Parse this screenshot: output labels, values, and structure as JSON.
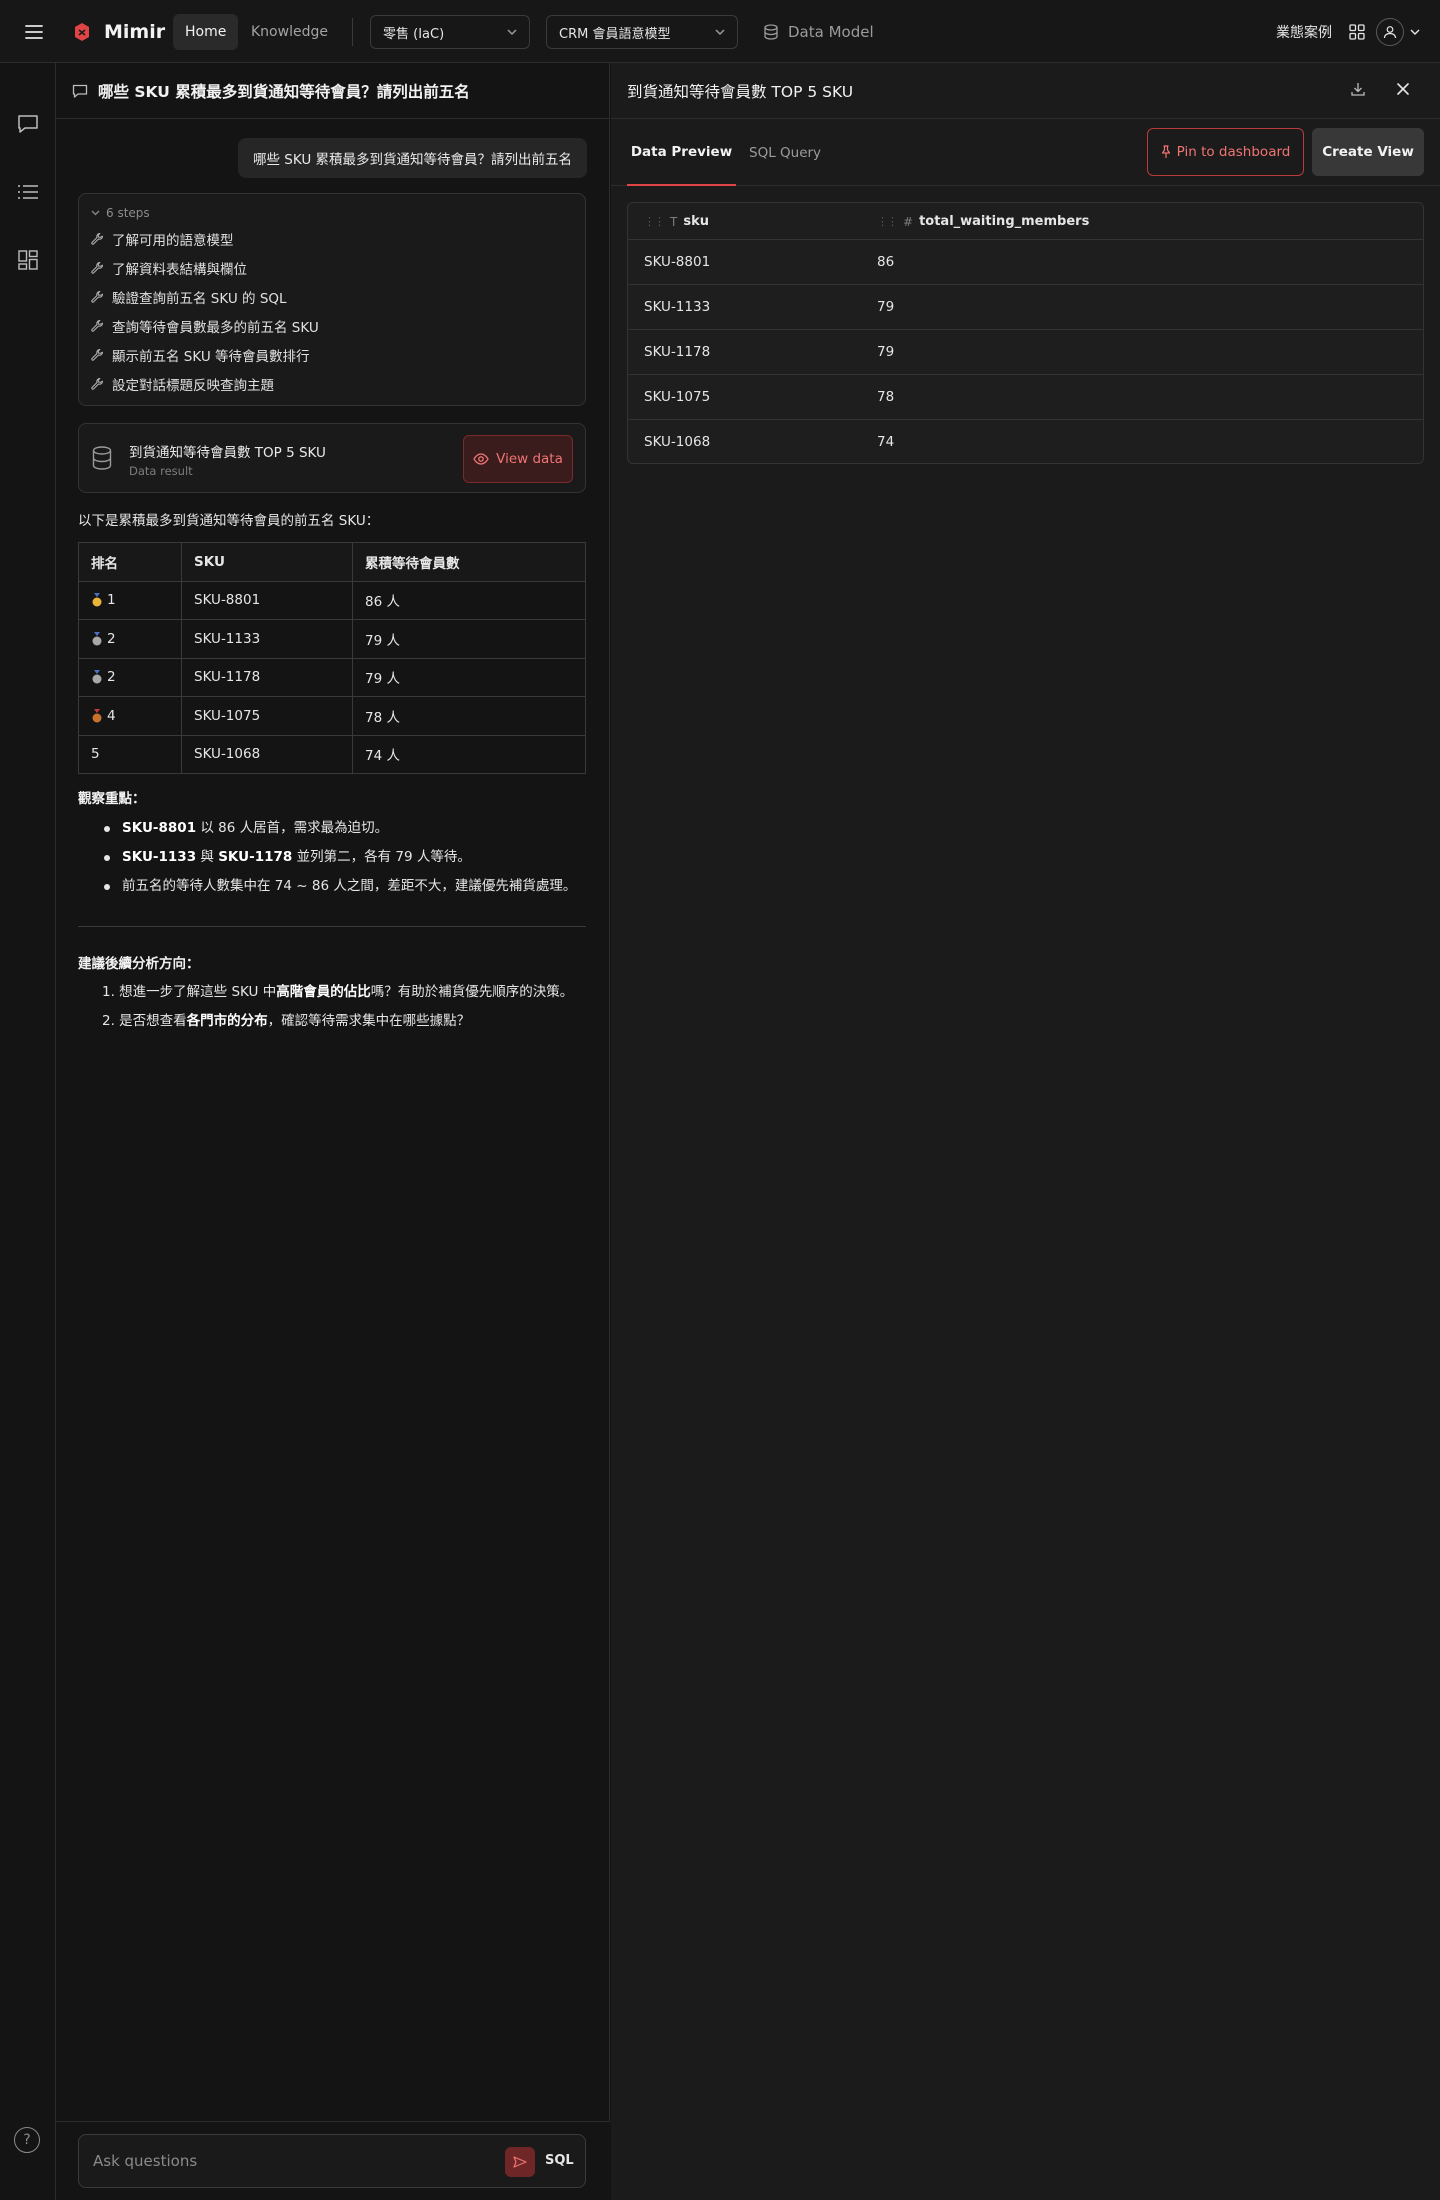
{
  "app": {
    "name": "Mimir"
  },
  "nav": {
    "home": "Home",
    "knowledge": "Knowledge"
  },
  "selectors": {
    "project": "零售 (IaC)",
    "model": "CRM 會員語意模型"
  },
  "data_model_label": "Data Model",
  "use_case_label": "業態案例",
  "chat": {
    "title": "哪些 SKU 累積最多到貨通知等待會員？請列出前五名",
    "user_message": "哪些 SKU 累積最多到貨通知等待會員？請列出前五名",
    "steps_label": "6 steps",
    "steps": [
      "了解可用的語意模型",
      "了解資料表結構與欄位",
      "驗證查詢前五名 SKU 的 SQL",
      "查詢等待會員數最多的前五名 SKU",
      "顯示前五名 SKU 等待會員數排行",
      "設定對話標題反映查詢主題"
    ],
    "result_card": {
      "title": "到貨通知等待會員數 TOP 5 SKU",
      "subtitle": "Data result",
      "button": "View data"
    },
    "intro": "以下是累積最多到貨通知等待會員的前五名 SKU：",
    "table": {
      "headers": [
        "排名",
        "SKU",
        "累積等待會員數"
      ],
      "rows": [
        {
          "rank": "1",
          "medal": "gold",
          "sku": "SKU-8801",
          "count": "86 人"
        },
        {
          "rank": "2",
          "medal": "silver",
          "sku": "SKU-1133",
          "count": "79 人"
        },
        {
          "rank": "2",
          "medal": "silver",
          "sku": "SKU-1178",
          "count": "79 人"
        },
        {
          "rank": "4",
          "medal": "bronze",
          "sku": "SKU-1075",
          "count": "78 人"
        },
        {
          "rank": "5",
          "medal": "",
          "sku": "SKU-1068",
          "count": "74 人"
        }
      ]
    },
    "observations_title": "觀察重點：",
    "observations": [
      {
        "b1": "SKU-8801",
        "t1": " 以 86 人居首，需求最為迫切。"
      },
      {
        "b1": "SKU-1133",
        "t1": " 與 ",
        "b2": "SKU-1178",
        "t2": " 並列第二，各有 79 人等待。"
      },
      {
        "t1": "前五名的等待人數集中在 74 ~ 86 人之間，差距不大，建議優先補貨處理。"
      }
    ],
    "next_title": "建議後續分析方向：",
    "next_steps": [
      {
        "t1": "1. 想進一步了解這些 SKU 中",
        "b1": "高階會員的佔比",
        "t2": "嗎？有助於補貨優先順序的決策。"
      },
      {
        "t1": "2. 是否想查看",
        "b1": "各門市的分布",
        "t2": "，確認等待需求集中在哪些據點？"
      }
    ],
    "input_placeholder": "Ask questions",
    "sql_label": "SQL"
  },
  "data_panel": {
    "title": "到貨通知等待會員數 TOP 5 SKU",
    "tabs": [
      "Data Preview",
      "SQL Query"
    ],
    "pin_button": "Pin to dashboard",
    "create_view_button": "Create View",
    "columns": [
      "sku",
      "total_waiting_members"
    ],
    "rows": [
      {
        "sku": "SKU-8801",
        "total": "86"
      },
      {
        "sku": "SKU-1133",
        "total": "79"
      },
      {
        "sku": "SKU-1178",
        "total": "79"
      },
      {
        "sku": "SKU-1075",
        "total": "78"
      },
      {
        "sku": "SKU-1068",
        "total": "74"
      }
    ]
  },
  "colors": {
    "accent": "#e04545",
    "medal_gold": "#e9b43a",
    "medal_silver": "#a8a8a8",
    "medal_bronze": "#c7722f"
  },
  "icons": [
    "menu-icon",
    "mimir-logo",
    "chevron-down-icon",
    "database-icon",
    "grid-apps-icon",
    "user-icon",
    "chat-bubble-icon",
    "list-icon",
    "dashboard-icon",
    "help-icon",
    "wrench-icon",
    "eye-icon",
    "send-icon",
    "download-icon",
    "close-icon",
    "pin-icon"
  ]
}
